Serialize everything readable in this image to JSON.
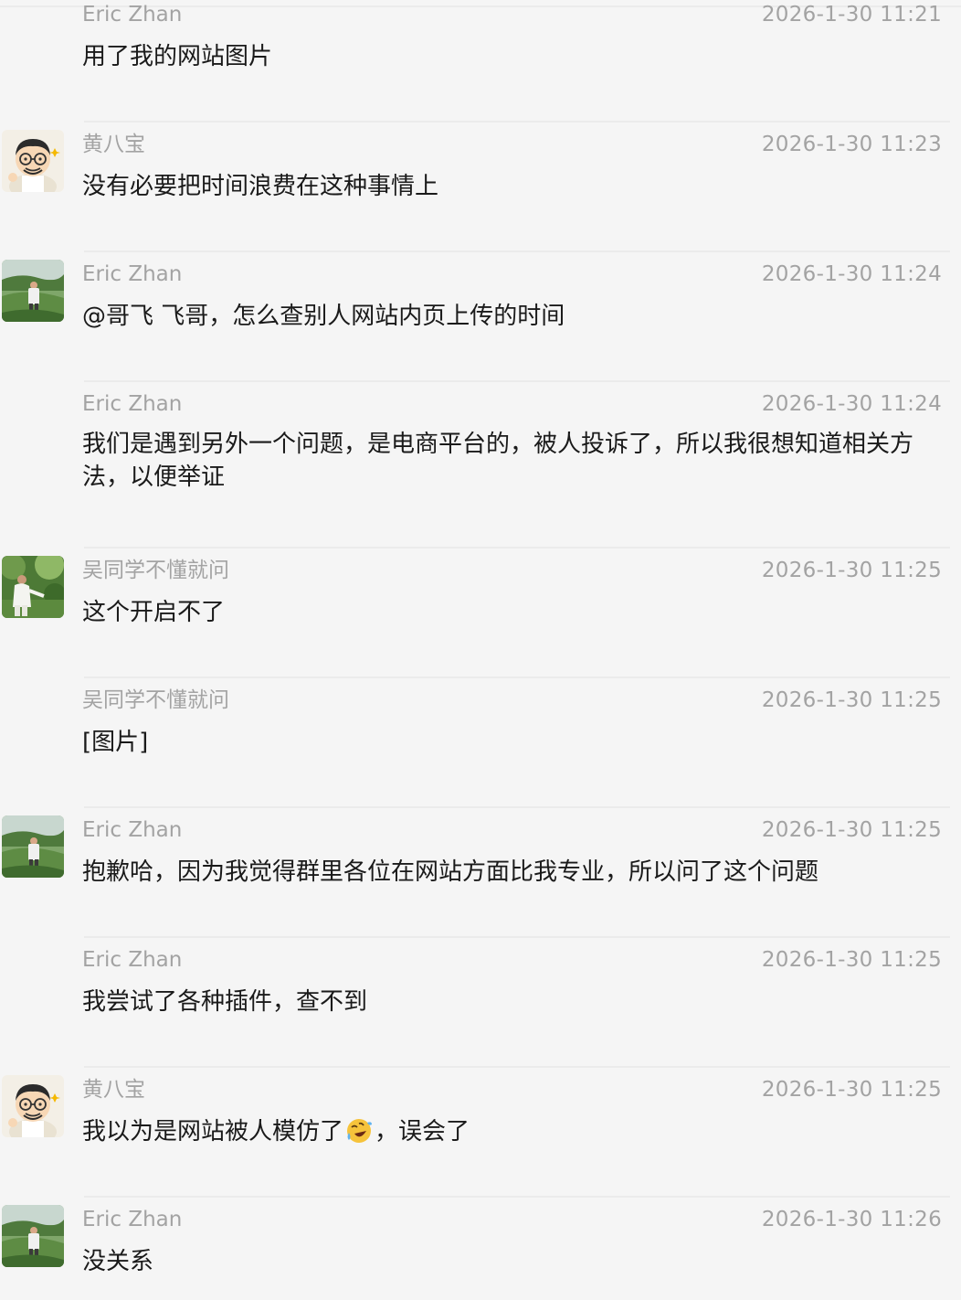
{
  "messages": [
    {
      "sender": "Eric Zhan",
      "time": "2026-1-30 11:21",
      "text": "用了我的网站图片",
      "avatar": "none"
    },
    {
      "sender": "黄八宝",
      "time": "2026-1-30 11:23",
      "text": "没有必要把时间浪费在这种事情上",
      "avatar": "cartoon-avatar"
    },
    {
      "sender": "Eric Zhan",
      "time": "2026-1-30 11:24",
      "text": "@哥飞 飞哥，怎么查别人网站内页上传的时间",
      "avatar": "outdoor-photo-avatar"
    },
    {
      "sender": "Eric Zhan",
      "time": "2026-1-30 11:24",
      "text": "我们是遇到另外一个问题，是电商平台的，被人投诉了，所以我很想知道相关方法，以便举证",
      "avatar": "none"
    },
    {
      "sender": "吴同学不懂就问",
      "time": "2026-1-30 11:25",
      "text": "这个开启不了",
      "avatar": "garden-photo-avatar"
    },
    {
      "sender": "吴同学不懂就问",
      "time": "2026-1-30 11:25",
      "text": "[图片]",
      "avatar": "none"
    },
    {
      "sender": "Eric Zhan",
      "time": "2026-1-30 11:25",
      "text": "抱歉哈，因为我觉得群里各位在网站方面比我专业，所以问了这个问题",
      "avatar": "outdoor-photo-avatar"
    },
    {
      "sender": "Eric Zhan",
      "time": "2026-1-30 11:25",
      "text": "我尝试了各种插件，查不到",
      "avatar": "none"
    },
    {
      "sender": "黄八宝",
      "time": "2026-1-30 11:25",
      "text_before_emoji": "我以为是网站被人模仿了",
      "emoji": "face-with-tears-of-joy-tilted-emoji",
      "text_after_emoji": "，误会了",
      "avatar": "cartoon-avatar"
    },
    {
      "sender": "Eric Zhan",
      "time": "2026-1-30 11:26",
      "text": "没关系",
      "avatar": "outdoor-photo-avatar"
    }
  ],
  "colors": {
    "background": "#f5f5f5",
    "meta_text": "#a3a3a3",
    "body_text": "#1a1a1a",
    "divider": "#ebebeb"
  }
}
